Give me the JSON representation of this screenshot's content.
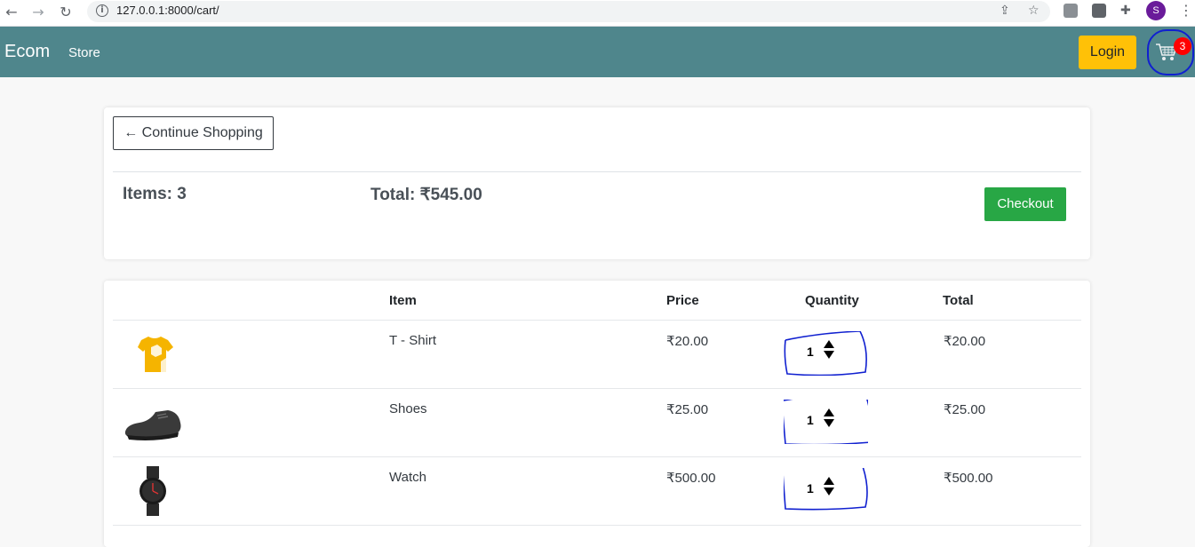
{
  "browser": {
    "url": "127.0.0.1:8000/cart/",
    "profile_initial": "S"
  },
  "navbar": {
    "brand": "Ecom",
    "store_link": "Store",
    "login_label": "Login",
    "cart_count": "3"
  },
  "summary": {
    "continue_label": "← Continue Shopping",
    "items_label": "Items: 3",
    "total_label": "Total: ₹545.00",
    "checkout_label": "Checkout"
  },
  "table": {
    "headers": [
      "Item",
      "Price",
      "Quantity",
      "Total"
    ],
    "rows": [
      {
        "name": "T - Shirt",
        "price": "₹20.00",
        "quantity": "1",
        "total": "₹20.00",
        "image": "tshirt-icon"
      },
      {
        "name": "Shoes",
        "price": "₹25.00",
        "quantity": "1",
        "total": "₹25.00",
        "image": "shoe-icon"
      },
      {
        "name": "Watch",
        "price": "₹500.00",
        "quantity": "1",
        "total": "₹500.00",
        "image": "watch-icon"
      }
    ]
  },
  "colors": {
    "navbar": "#4f868c",
    "login": "#ffc107",
    "checkout": "#28a745",
    "badge": "#ff0000",
    "annotation_ink": "#1020d0"
  }
}
